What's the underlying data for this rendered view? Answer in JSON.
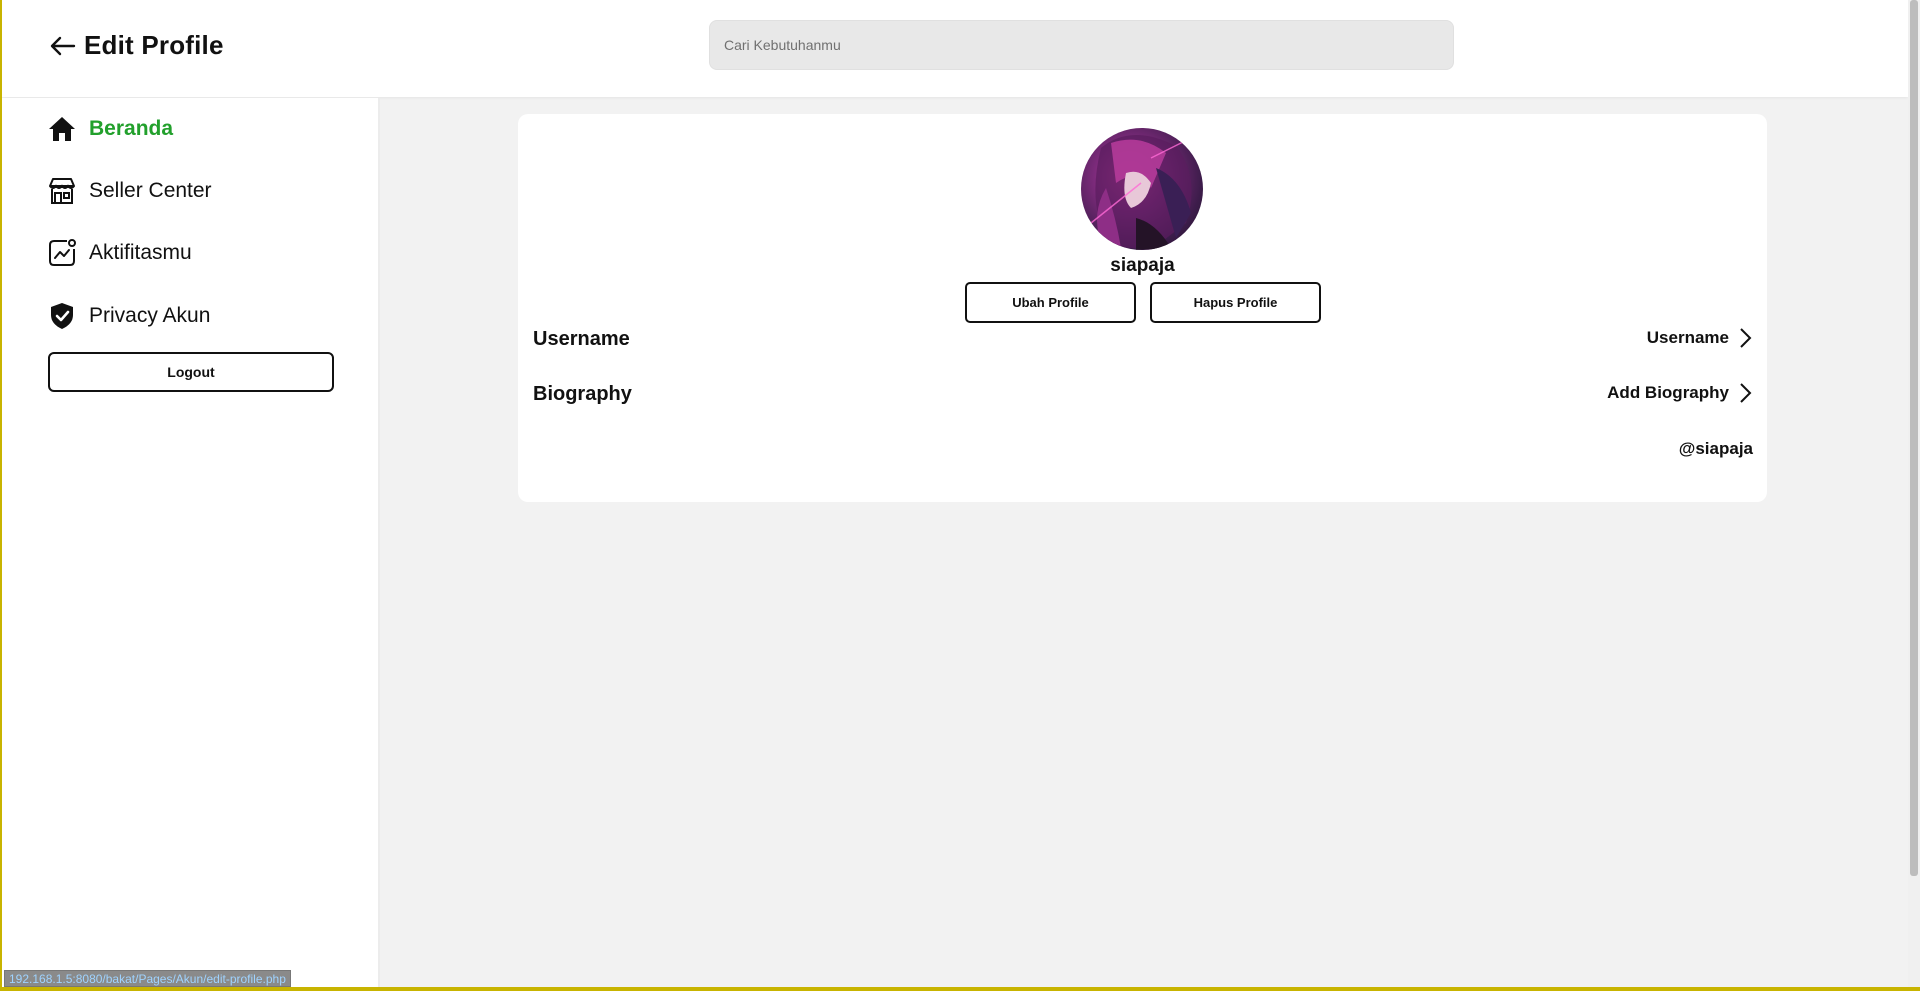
{
  "header": {
    "title": "Edit Profile",
    "search_placeholder": "Cari Kebutuhanmu"
  },
  "sidebar": {
    "items": [
      {
        "label": "Beranda",
        "icon": "home-icon",
        "active": true
      },
      {
        "label": "Seller Center",
        "icon": "store-icon",
        "active": false
      },
      {
        "label": "Aktifitasmu",
        "icon": "activity-chart-icon",
        "active": false
      },
      {
        "label": "Privacy Akun",
        "icon": "shield-check-icon",
        "active": false
      }
    ],
    "logout_label": "Logout"
  },
  "profile": {
    "name": "siapaja",
    "edit_button": "Ubah Profile",
    "delete_button": "Hapus Profile",
    "rows": [
      {
        "label": "Username",
        "value": "Username"
      },
      {
        "label": "Biography",
        "value": "Add Biography"
      }
    ],
    "handle": "@siapaja"
  },
  "status_bar": {
    "url": "192.168.1.5:8080/bakat/Pages/Akun/edit-profile.php"
  },
  "colors": {
    "active_nav": "#22a02c",
    "page_background": "#f2f2f2",
    "window_border": "#c8b400"
  }
}
